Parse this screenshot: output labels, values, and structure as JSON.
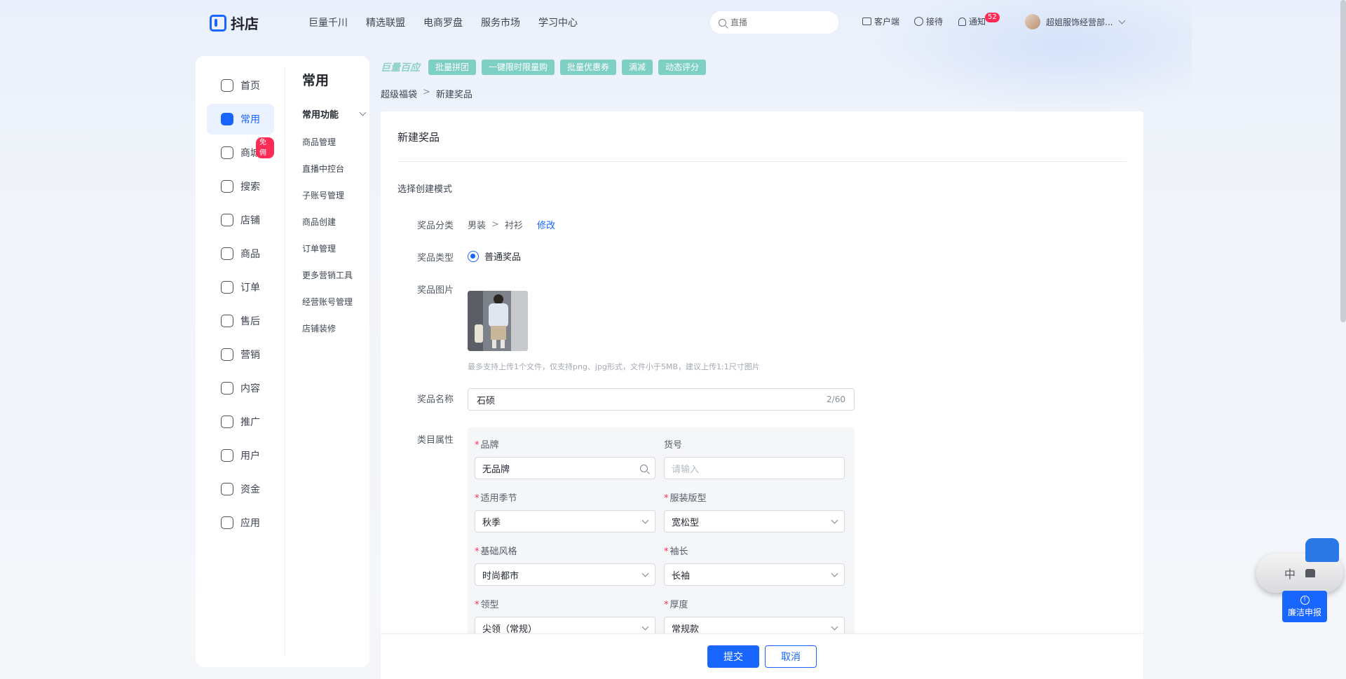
{
  "brand": {
    "name": "抖店"
  },
  "topnav": [
    "巨量千川",
    "精选联盟",
    "电商罗盘",
    "服务市场",
    "学习中心"
  ],
  "search": {
    "placeholder": "直播"
  },
  "tools": {
    "client": "客户端",
    "reception": "接待",
    "notify": "通知",
    "notify_count": "52",
    "account": "超姐服饰经营部..."
  },
  "sidebar": {
    "items": [
      {
        "label": "首页"
      },
      {
        "label": "常用"
      },
      {
        "label": "商城"
      },
      {
        "label": "搜索"
      },
      {
        "label": "店铺"
      },
      {
        "label": "商品"
      },
      {
        "label": "订单"
      },
      {
        "label": "售后"
      },
      {
        "label": "营销"
      },
      {
        "label": "内容"
      },
      {
        "label": "推广"
      },
      {
        "label": "用户"
      },
      {
        "label": "资金"
      },
      {
        "label": "应用"
      }
    ],
    "mall_badge": "免佣",
    "sub_title": "常用",
    "sub_group": "常用功能",
    "sub_items": [
      "商品管理",
      "直播中控台",
      "子账号管理",
      "商品创建",
      "订单管理",
      "更多营销工具",
      "经营账号管理",
      "店铺装修"
    ]
  },
  "strip": {
    "logo": "巨量百应",
    "chips": [
      "批量拼团",
      "一键限时限量购",
      "批量优惠券",
      "满减",
      "动态评分"
    ]
  },
  "breadcrumb": {
    "parent": "超级福袋",
    "current": "新建奖品"
  },
  "form": {
    "title": "新建奖品",
    "section": "选择创建模式",
    "category_label": "奖品分类",
    "category_path": [
      "男装",
      "衬衫"
    ],
    "category_edit": "修改",
    "type_label": "奖品类型",
    "type_value": "普通奖品",
    "image_label": "奖品图片",
    "image_hint": "最多支持上传1个文件，仅支持png、jpg形式，文件小于5MB，建议上传1:1尺寸图片",
    "name_label": "奖品名称",
    "name_value": "石硕",
    "name_counter": "2/60",
    "attr_label": "类目属性",
    "attrs": {
      "brand": {
        "label": "品牌",
        "value": "无品牌"
      },
      "sku": {
        "label": "货号",
        "placeholder": "请输入"
      },
      "season": {
        "label": "适用季节",
        "value": "秋季"
      },
      "fit": {
        "label": "服装版型",
        "value": "宽松型"
      },
      "style": {
        "label": "基础风格",
        "value": "时尚都市"
      },
      "sleeve": {
        "label": "袖长",
        "value": "长袖"
      },
      "collar": {
        "label": "领型",
        "value": "尖领（常规）"
      },
      "thickness": {
        "label": "厚度",
        "value": "常规款"
      }
    }
  },
  "footer": {
    "submit": "提交",
    "cancel": "取消"
  },
  "floating": {
    "im_text": "中",
    "report": "廉洁申报"
  }
}
